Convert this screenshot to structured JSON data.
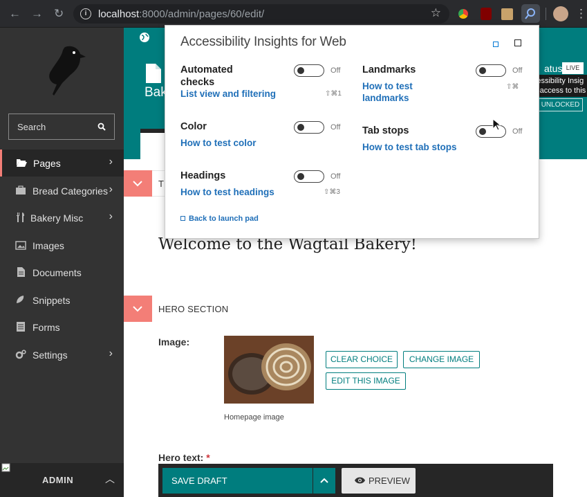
{
  "browser": {
    "url_host": "localhost",
    "url_path": ":8000/admin/pages/60/edit/",
    "icons": [
      "back-arrow-icon",
      "forward-arrow-icon",
      "reload-icon",
      "info-icon",
      "star-icon"
    ]
  },
  "sidebar": {
    "search_placeholder": "Search",
    "items": [
      {
        "label": "Pages",
        "icon": "folder-open-icon",
        "has_children": true,
        "active": true
      },
      {
        "label": "Bread Categories",
        "icon": "suitcase-icon",
        "has_children": true
      },
      {
        "label": "Bakery Misc",
        "icon": "utensils-icon",
        "has_children": true
      },
      {
        "label": "Images",
        "icon": "image-icon",
        "has_children": false
      },
      {
        "label": "Documents",
        "icon": "document-icon",
        "has_children": false
      },
      {
        "label": "Snippets",
        "icon": "snippet-icon",
        "has_children": false
      },
      {
        "label": "Forms",
        "icon": "form-icon",
        "has_children": false
      },
      {
        "label": "Settings",
        "icon": "cogs-icon",
        "has_children": true
      }
    ],
    "admin_label": "ADMIN"
  },
  "header": {
    "title_fragment": "Bak",
    "status_fragment": "atus",
    "live_badge": "LIVE",
    "tooltip_line1": "Accessibility Insig",
    "tooltip_line2": "Has access to this",
    "unlocked_badge": "UNLOCKED"
  },
  "editor": {
    "section1_title_fragment": "TI",
    "welcome_heading": "Welcome to the Wagtail Bakery!",
    "hero_section_title": "HERO SECTION",
    "image_label": "Image:",
    "clear_choice": "CLEAR CHOICE",
    "change_image": "CHANGE IMAGE",
    "edit_this_image": "EDIT THIS IMAGE",
    "image_caption": "Homepage image",
    "hero_text_label": "Hero text:",
    "required_marker": "*"
  },
  "footer": {
    "save_draft": "SAVE DRAFT",
    "preview": "PREVIEW"
  },
  "popup": {
    "title": "Accessibility Insights for Web",
    "items": {
      "automated": {
        "name_line1": "Automated",
        "name_line2": "checks",
        "link": "List view and filtering",
        "state": "Off",
        "shortcut": "⇧⌘1"
      },
      "landmarks": {
        "name": "Landmarks",
        "link_line1": "How to test",
        "link_line2": "landmarks",
        "state": "Off",
        "shortcut": "⇧⌘"
      },
      "color": {
        "name": "Color",
        "link": "How to test color",
        "state": "Off"
      },
      "tabstops": {
        "name": "Tab stops",
        "link": "How to test tab stops",
        "state": "Off"
      },
      "headings": {
        "name": "Headings",
        "link": "How to test headings",
        "state": "Off",
        "shortcut": "⇧⌘3"
      }
    },
    "back_link": "Back to launch pad"
  }
}
